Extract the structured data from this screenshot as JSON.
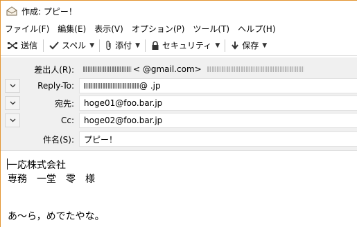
{
  "window": {
    "title": "作成: プピー！"
  },
  "menu": [
    "ファイル(F)",
    "編集(E)",
    "表示(V)",
    "オプション(P)",
    "ツール(T)",
    "ヘルプ(H)"
  ],
  "toolbar": {
    "send": "送信",
    "spell": "スペル",
    "attach": "添付",
    "security": "セキュリティ",
    "save": "保存"
  },
  "headers": {
    "from_label": "差出人(R):",
    "from_value": "<  @gmail.com>",
    "replyto_label": "Reply-To:",
    "replyto_value": "@  .jp",
    "to_label": "宛先:",
    "to_value": "hoge01@foo.bar.jp",
    "cc_label": "Cc:",
    "cc_value": "hoge02@foo.bar.jp",
    "subject_label": "件名(S):",
    "subject_value": "プピー！"
  },
  "body": {
    "line1": "一応株式会社",
    "line2": "専務　一堂　零　様",
    "line3": "あ〜ら，めでたやな。"
  }
}
